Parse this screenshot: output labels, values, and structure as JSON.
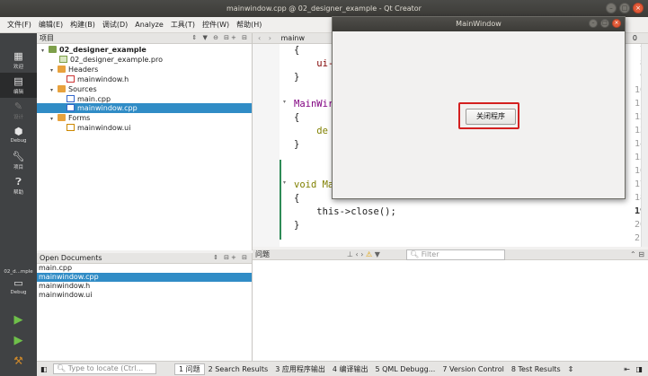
{
  "window": {
    "title": "mainwindow.cpp @ 02_designer_example - Qt Creator"
  },
  "menubar": [
    "文件(F)",
    "编辑(E)",
    "构建(B)",
    "调试(D)",
    "Analyze",
    "工具(T)",
    "控件(W)",
    "帮助(H)"
  ],
  "modebar": {
    "items": [
      {
        "label": "欢迎",
        "icon": "grid-icon"
      },
      {
        "label": "编辑",
        "icon": "edit-icon"
      },
      {
        "label": "设计",
        "icon": "pencil-icon"
      },
      {
        "label": "Debug",
        "icon": "bug-icon"
      },
      {
        "label": "项目",
        "icon": "wrench-icon"
      },
      {
        "label": "帮助",
        "icon": "help-icon"
      }
    ],
    "kit_label": "02_d...mple",
    "kit_mode": "Debug"
  },
  "project_pane": {
    "header": "项目",
    "tree": [
      {
        "label": "02_designer_example",
        "bold": true
      },
      {
        "label": "02_designer_example.pro"
      },
      {
        "label": "Headers"
      },
      {
        "label": "mainwindow.h"
      },
      {
        "label": "Sources"
      },
      {
        "label": "main.cpp"
      },
      {
        "label": "mainwindow.cpp",
        "selected": true
      },
      {
        "label": "Forms"
      },
      {
        "label": "mainwindow.ui"
      }
    ]
  },
  "open_documents": {
    "header": "Open Documents",
    "items": [
      "main.cpp",
      "mainwindow.cpp",
      "mainwindow.h",
      "mainwindow.ui"
    ],
    "selected": "mainwindow.cpp"
  },
  "editor": {
    "tab_label": "mainw",
    "tab_right": "0",
    "lines": [
      {
        "n": "7",
        "text": "{"
      },
      {
        "n": "8",
        "text": "    ui-"
      },
      {
        "n": "9",
        "text": "}"
      },
      {
        "n": "10",
        "text": ""
      },
      {
        "n": "11",
        "text": "MainWir"
      },
      {
        "n": "12",
        "text": "{"
      },
      {
        "n": "13",
        "text": "    de"
      },
      {
        "n": "14",
        "text": "}"
      },
      {
        "n": "15",
        "text": ""
      },
      {
        "n": "16",
        "text": ""
      },
      {
        "n": "17",
        "text": "void Ma"
      },
      {
        "n": "18",
        "text": "{"
      },
      {
        "n": "19",
        "text": "    this->close();"
      },
      {
        "n": "20",
        "text": "}"
      },
      {
        "n": "21",
        "text": ""
      }
    ]
  },
  "issues_pane": {
    "header": "问题",
    "filter_placeholder": "Filter"
  },
  "output_bar": {
    "locator_placeholder": "Type to locate (Ctrl...",
    "tabs": [
      "1 问题",
      "2 Search Results",
      "3 应用程序输出",
      "4 编译输出",
      "5 QML Debugg...",
      "7 Version Control",
      "8 Test Results"
    ]
  },
  "main_window": {
    "title": "MainWindow",
    "button_label": "关闭程序"
  }
}
